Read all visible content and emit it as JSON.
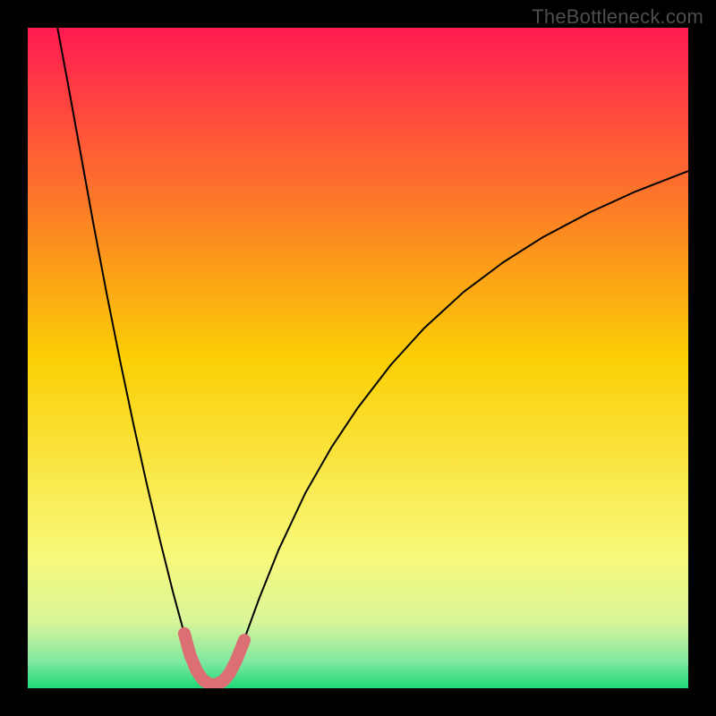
{
  "watermark": "TheBottleneck.com",
  "chart_data": {
    "type": "line",
    "title": "",
    "xlabel": "",
    "ylabel": "",
    "xlim": [
      0,
      100
    ],
    "ylim": [
      0,
      100
    ],
    "grid": false,
    "legend": false,
    "background": {
      "type": "vertical-gradient",
      "stops": [
        {
          "pos": 0.0,
          "color": "#ff1a51"
        },
        {
          "pos": 0.5,
          "color": "#fbcf04"
        },
        {
          "pos": 0.8,
          "color": "#f8f97a"
        },
        {
          "pos": 0.9,
          "color": "#d9f59a"
        },
        {
          "pos": 0.96,
          "color": "#7fe8a0"
        },
        {
          "pos": 1.0,
          "color": "#1ed977"
        }
      ]
    },
    "series": [
      {
        "name": "bottleneck-curve",
        "stroke": "#000000",
        "stroke_width": 2,
        "data": [
          {
            "x": 4.5,
            "y": 100.0
          },
          {
            "x": 6.0,
            "y": 92.0
          },
          {
            "x": 8.0,
            "y": 81.0
          },
          {
            "x": 10.0,
            "y": 70.0
          },
          {
            "x": 12.0,
            "y": 59.5
          },
          {
            "x": 14.0,
            "y": 49.5
          },
          {
            "x": 16.0,
            "y": 40.0
          },
          {
            "x": 18.0,
            "y": 31.0
          },
          {
            "x": 20.0,
            "y": 22.5
          },
          {
            "x": 22.0,
            "y": 14.5
          },
          {
            "x": 23.5,
            "y": 9.0
          },
          {
            "x": 24.5,
            "y": 5.5
          },
          {
            "x": 25.5,
            "y": 2.8
          },
          {
            "x": 26.5,
            "y": 1.2
          },
          {
            "x": 27.5,
            "y": 0.5
          },
          {
            "x": 28.5,
            "y": 0.5
          },
          {
            "x": 29.5,
            "y": 1.0
          },
          {
            "x": 30.5,
            "y": 2.2
          },
          {
            "x": 31.5,
            "y": 4.2
          },
          {
            "x": 33.0,
            "y": 8.0
          },
          {
            "x": 35.0,
            "y": 13.5
          },
          {
            "x": 38.0,
            "y": 21.0
          },
          {
            "x": 42.0,
            "y": 29.5
          },
          {
            "x": 46.0,
            "y": 36.5
          },
          {
            "x": 50.0,
            "y": 42.5
          },
          {
            "x": 55.0,
            "y": 49.0
          },
          {
            "x": 60.0,
            "y": 54.5
          },
          {
            "x": 66.0,
            "y": 60.0
          },
          {
            "x": 72.0,
            "y": 64.5
          },
          {
            "x": 78.0,
            "y": 68.3
          },
          {
            "x": 85.0,
            "y": 72.0
          },
          {
            "x": 92.0,
            "y": 75.2
          },
          {
            "x": 100.0,
            "y": 78.3
          }
        ]
      },
      {
        "name": "bottom-highlight",
        "stroke": "#db6f74",
        "stroke_width": 14,
        "linecap": "round",
        "data": [
          {
            "x": 23.7,
            "y": 8.3
          },
          {
            "x": 24.6,
            "y": 5.0
          },
          {
            "x": 25.6,
            "y": 2.6
          },
          {
            "x": 26.6,
            "y": 1.2
          },
          {
            "x": 27.6,
            "y": 0.6
          },
          {
            "x": 28.6,
            "y": 0.6
          },
          {
            "x": 29.6,
            "y": 1.1
          },
          {
            "x": 30.6,
            "y": 2.3
          },
          {
            "x": 31.6,
            "y": 4.3
          },
          {
            "x": 32.8,
            "y": 7.3
          }
        ]
      }
    ]
  }
}
